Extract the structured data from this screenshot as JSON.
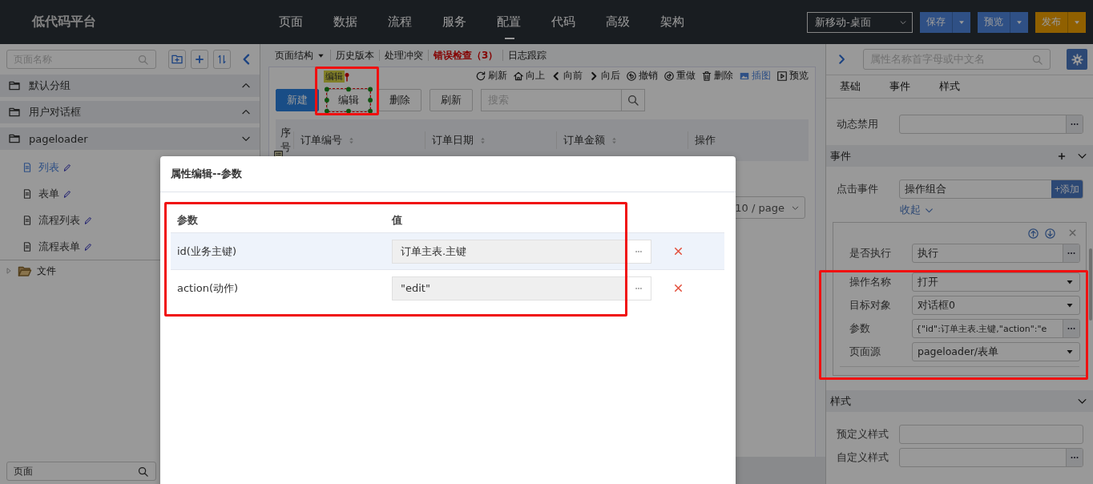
{
  "topbar": {
    "logo": "低代码平台",
    "nav": [
      {
        "label": "页面",
        "selected": false
      },
      {
        "label": "数据",
        "selected": false
      },
      {
        "label": "流程",
        "selected": false
      },
      {
        "label": "服务",
        "selected": false
      },
      {
        "label": "配置",
        "selected": true
      },
      {
        "label": "代码",
        "selected": false
      },
      {
        "label": "高级",
        "selected": false
      },
      {
        "label": "架构",
        "selected": false
      }
    ],
    "device": "新移动-桌面",
    "buttons": [
      {
        "label": "保存",
        "kind": "primary"
      },
      {
        "label": "预览",
        "kind": "primary"
      },
      {
        "label": "发布",
        "kind": "warning"
      }
    ]
  },
  "sidebar": {
    "search": {
      "placeholder": "页面名称"
    },
    "groups": [
      {
        "label": "默认分组",
        "expanded": false
      },
      {
        "label": "用户对话框",
        "expanded": false
      },
      {
        "label": "pageloader",
        "expanded": true,
        "children": [
          {
            "label": "列表",
            "selected": true
          },
          {
            "label": "表单",
            "selected": false
          },
          {
            "label": "流程列表",
            "selected": false
          },
          {
            "label": "流程表单",
            "selected": false
          }
        ]
      }
    ],
    "tree": [
      {
        "label": "文件",
        "expanded": false
      }
    ],
    "bottom_search": {
      "placeholder": "页面"
    }
  },
  "designer": {
    "tabs": [
      {
        "label": "页面结构",
        "kind": "dropdown"
      },
      {
        "label": "历史版本",
        "kind": "plain"
      },
      {
        "label": "处理冲突",
        "kind": "plain"
      },
      {
        "label": "错误检查（3）",
        "kind": "error"
      },
      {
        "label": "日志跟踪",
        "kind": "plain"
      }
    ],
    "selected_component": "编辑",
    "actions": [
      {
        "label": "刷新",
        "kind": "refresh",
        "active": false
      },
      {
        "label": "向上",
        "kind": "home",
        "active": false
      },
      {
        "label": "向前",
        "kind": "back",
        "active": false
      },
      {
        "label": "向后",
        "kind": "forward",
        "active": false
      },
      {
        "label": "撤销",
        "kind": "undo",
        "active": false
      },
      {
        "label": "重做",
        "kind": "redo",
        "active": false
      },
      {
        "label": "删除",
        "kind": "trash",
        "active": false
      },
      {
        "label": "插图",
        "kind": "image",
        "active": true
      },
      {
        "label": "预览",
        "kind": "play",
        "active": false
      }
    ],
    "canvas": {
      "buttons": [
        {
          "label": "新建",
          "kind": "primary",
          "selected": false
        },
        {
          "label": "编辑",
          "kind": "default",
          "selected": true
        },
        {
          "label": "删除",
          "kind": "default",
          "selected": false
        },
        {
          "label": "刷新",
          "kind": "default",
          "selected": false
        }
      ],
      "search": {
        "placeholder": "搜索"
      },
      "columns": [
        {
          "label": "序号",
          "sortable": false
        },
        {
          "label": "订单编号",
          "sortable": true
        },
        {
          "label": "订单日期",
          "sortable": true
        },
        {
          "label": "订单金额",
          "sortable": true
        },
        {
          "label": "操作",
          "sortable": false
        }
      ],
      "page_size": "10 / page"
    }
  },
  "dialog": {
    "title": "属性编辑--参数",
    "columns": [
      "参数",
      "值"
    ],
    "rows": [
      {
        "name": "id(业务主键)",
        "value": "订单主表.主键",
        "selected": true
      },
      {
        "name": "action(动作)",
        "value": "\"edit\"",
        "selected": false
      }
    ]
  },
  "properties": {
    "search": {
      "placeholder": "属性名称首字母或中文名"
    },
    "tabs": [
      "基础",
      "事件",
      "样式"
    ],
    "basic_fields": [
      {
        "label": "动态禁用",
        "kind": "dialog"
      }
    ],
    "event_section": {
      "title": "事件",
      "fields": [
        {
          "label": "点击事件",
          "value": "操作组合",
          "add_label": "+添加"
        }
      ],
      "collapse_label": "收起",
      "action_fields": [
        {
          "label": "是否执行",
          "value": "执行",
          "kind": "dialog"
        },
        {
          "label": "操作名称",
          "value": "打开",
          "kind": "select"
        },
        {
          "label": "目标对象",
          "value": "对话框0",
          "kind": "select"
        },
        {
          "label": "参数",
          "value": "{\"id\":订单主表.主键,\"action\":\"e",
          "kind": "dialog"
        },
        {
          "label": "页面源",
          "value": "pageloader/表单",
          "kind": "select"
        }
      ]
    },
    "style_section": {
      "title": "样式",
      "fields": [
        {
          "label": "预定义样式",
          "kind": "text"
        },
        {
          "label": "自定义样式",
          "kind": "dialog"
        }
      ]
    }
  }
}
